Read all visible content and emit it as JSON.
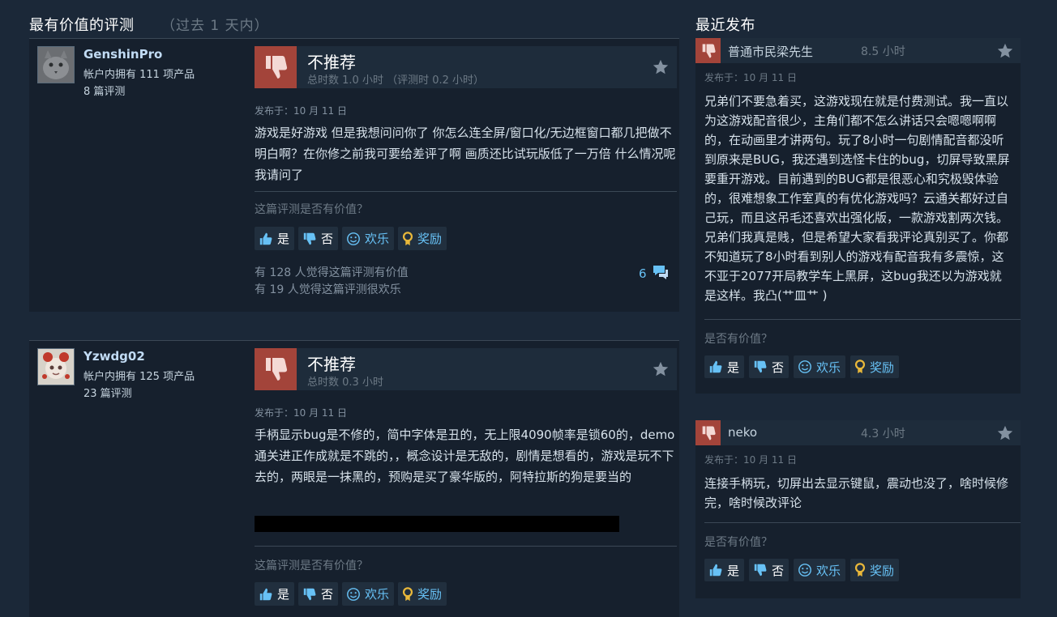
{
  "most_helpful": {
    "title": "最有价值的评测",
    "subtitle": "（过去 1 天内）"
  },
  "recent": {
    "title": "最近发布"
  },
  "reviews": [
    {
      "username": "GenshinPro",
      "products": "帐户内拥有 111 项产品",
      "review_count": "8 篇评测",
      "verdict": "不推荐",
      "hours": "总时数 1.0 小时 （评测时 0.2 小时）",
      "posted": "发布于：10 月 11 日",
      "body": "游戏是好游戏 但是我想问问你了 你怎么连全屏/窗口化/无边框窗口都几把做不明白啊？在你修之前我可要给差评了啊 画质还比试玩版低了一万倍 什么情况呢我请问了",
      "helpful_question": "这篇评测是否有价值？",
      "btn_yes": "是",
      "btn_no": "否",
      "btn_funny": "欢乐",
      "btn_award": "奖励",
      "helpful_stat": "有 128 人觉得这篇评测有价值",
      "funny_stat": "有 19 人觉得这篇评测很欢乐",
      "comments": "6"
    },
    {
      "username": "Yzwdg02",
      "products": "帐户内拥有 125 项产品",
      "review_count": "23 篇评测",
      "verdict": "不推荐",
      "hours": "总时数 0.3 小时",
      "posted": "发布于：10 月 11 日",
      "body": "手柄显示bug是不修的，简中字体是丑的，无上限4090帧率是锁60的，demo通关进正作成就是不跳的，，概念设计是无敌的，剧情是想看的，游戏是玩不下去的，两眼是一抹黑的，预购是买了豪华版的，阿特拉斯的狗是要当的",
      "helpful_question": "这篇评测是否有价值？",
      "btn_yes": "是",
      "btn_no": "否",
      "btn_funny": "欢乐",
      "btn_award": "奖励"
    }
  ],
  "recent_reviews": [
    {
      "username": "普通市民梁先生",
      "hours": "8.5 小时",
      "posted": "发布于：10 月 11 日",
      "body": "兄弟们不要急着买，这游戏现在就是付费测试。我一直以为这游戏配音很少，主角们都不怎么讲话只会嗯嗯啊啊的，在动画里才讲两句。玩了8小时一句剧情配音都没听到原来是BUG，我还遇到选怪卡住的bug，切屏导致黑屏要重开游戏。目前遇到的BUG都是很恶心和究极毁体验的，很难想象工作室真的有优化游戏吗？云通关都好过自己玩，而且这吊毛还喜欢出强化版，一款游戏割两次钱。兄弟们我真是贱，但是希望大家看我评论真别买了。你都不知道玩了8小时看到别人的游戏有配音我有多震惊，这不亚于2077开局教学车上黑屏，这bug我还以为游戏就是这样。我凸(艹皿艹 )",
      "question": "是否有价值？",
      "btn_yes": "是",
      "btn_no": "否",
      "btn_funny": "欢乐",
      "btn_award": "奖励"
    },
    {
      "username": "neko",
      "hours": "4.3 小时",
      "posted": "发布于：10 月 11 日",
      "body": "连接手柄玩，切屏出去显示键鼠，震动也没了，啥时候修完，啥时候改评论",
      "question": "是否有价值？",
      "btn_yes": "是",
      "btn_no": "否",
      "btn_funny": "欢乐",
      "btn_award": "奖励"
    }
  ],
  "colors": {
    "background": "#1b2838",
    "card": "#16202d",
    "thumbs_down": "#a3443a",
    "link": "#67c1f5",
    "award": "#e9b83a"
  }
}
